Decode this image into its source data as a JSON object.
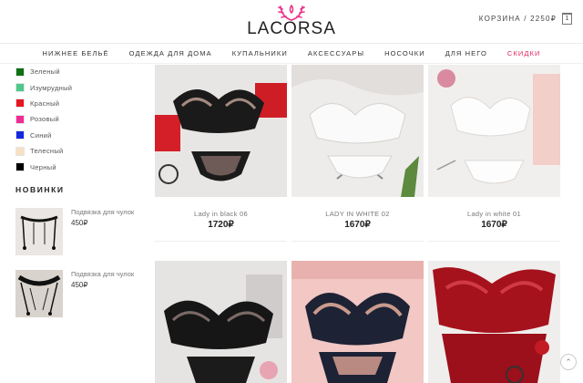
{
  "header": {
    "logo_text": "LACORSA",
    "cart_label": "КОРЗИНА / 2250₽",
    "cart_count": "1"
  },
  "nav": {
    "items": [
      "НИЖНЕЕ БЕЛЬЁ",
      "ОДЕЖДА ДЛЯ ДОМА",
      "КУПАЛЬНИКИ",
      "АКСЕССУАРЫ",
      "НОСОЧКИ",
      "ДЛЯ НЕГО",
      "СКИДКИ"
    ]
  },
  "sidebar": {
    "colors": [
      {
        "label": "Зеленый",
        "hex": "#0e6f14"
      },
      {
        "label": "Изумрудный",
        "hex": "#4ec98a"
      },
      {
        "label": "Красный",
        "hex": "#e8151f"
      },
      {
        "label": "Розовый",
        "hex": "#f02b93"
      },
      {
        "label": "Синий",
        "hex": "#1428e0"
      },
      {
        "label": "Телесный",
        "hex": "#f6e1c2"
      },
      {
        "label": "Черный",
        "hex": "#000000"
      }
    ],
    "new_title": "НОВИНКИ",
    "new_items": [
      {
        "name": "Подвязка для чулок",
        "price": "450₽"
      },
      {
        "name": "Подвязка для чулок",
        "price": "450₽"
      }
    ]
  },
  "products": [
    {
      "name": "Lady in black 06",
      "price": "1720₽"
    },
    {
      "name": "LADY IN WHITE 02",
      "price": "1670₽"
    },
    {
      "name": "Lady in white 01",
      "price": "1670₽"
    },
    {
      "name": "",
      "price": ""
    },
    {
      "name": "",
      "price": ""
    },
    {
      "name": "",
      "price": ""
    }
  ],
  "colors": {
    "accent": "#e0245e",
    "logo_pink": "#e8348a"
  }
}
